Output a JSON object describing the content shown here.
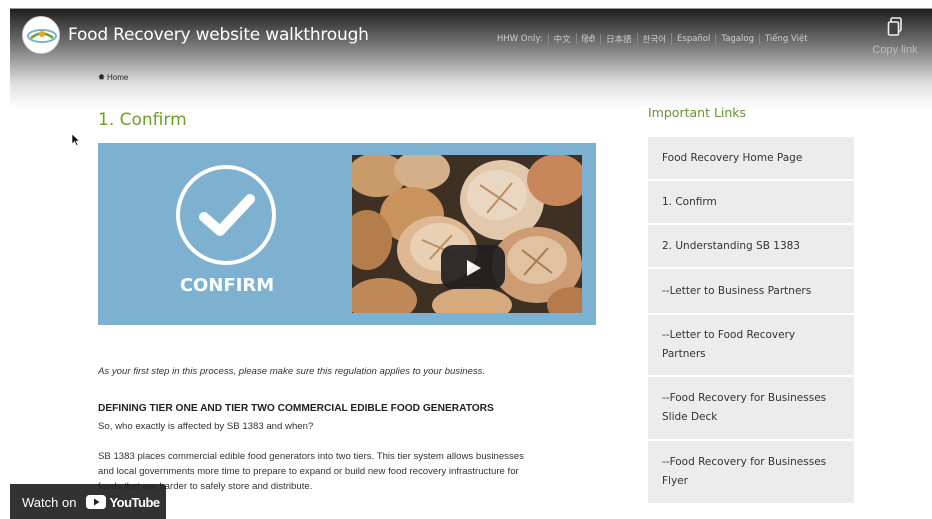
{
  "player": {
    "title": "Food Recovery website walkthrough",
    "copy_link_label": "Copy link",
    "watch_on_label": "Watch on",
    "youtube_label": "YouTube"
  },
  "header": {
    "languages": [
      "HHW Only:",
      "中文",
      "हिंदी",
      "日本語",
      "한국어",
      "Español",
      "Tagalog",
      "Tiếng Việt"
    ]
  },
  "breadcrumb": {
    "label": "Home"
  },
  "main": {
    "heading": "1. Confirm",
    "banner_label": "CONFIRM",
    "intro": "As your first step in this process, please make sure this regulation applies to your business.",
    "section_heading": "DEFINING TIER ONE AND TIER TWO COMMERCIAL EDIBLE FOOD GENERATORS",
    "section_question": "So, who exactly is affected by SB 1383 and when?",
    "section_body_1": "SB 1383 places commercial edible food generators into two tiers. This tier system allows businesses",
    "section_body_2": "and local governments more time to prepare to expand or build new food recovery infrastructure for",
    "section_body_3": "foods that are harder to safely store and distribute."
  },
  "sidebar": {
    "heading": "Important Links",
    "links": [
      "Food Recovery Home Page",
      "1. Confirm",
      "2. Understanding SB 1383",
      "--Letter to Business Partners",
      "--Letter to Food Recovery Partners",
      "--Food Recovery for Businesses Slide Deck",
      "--Food Recovery for Businesses Flyer"
    ]
  },
  "colors": {
    "accent_green": "#6aa226",
    "banner_blue": "#7db1cf",
    "link_bg": "#ececec"
  }
}
